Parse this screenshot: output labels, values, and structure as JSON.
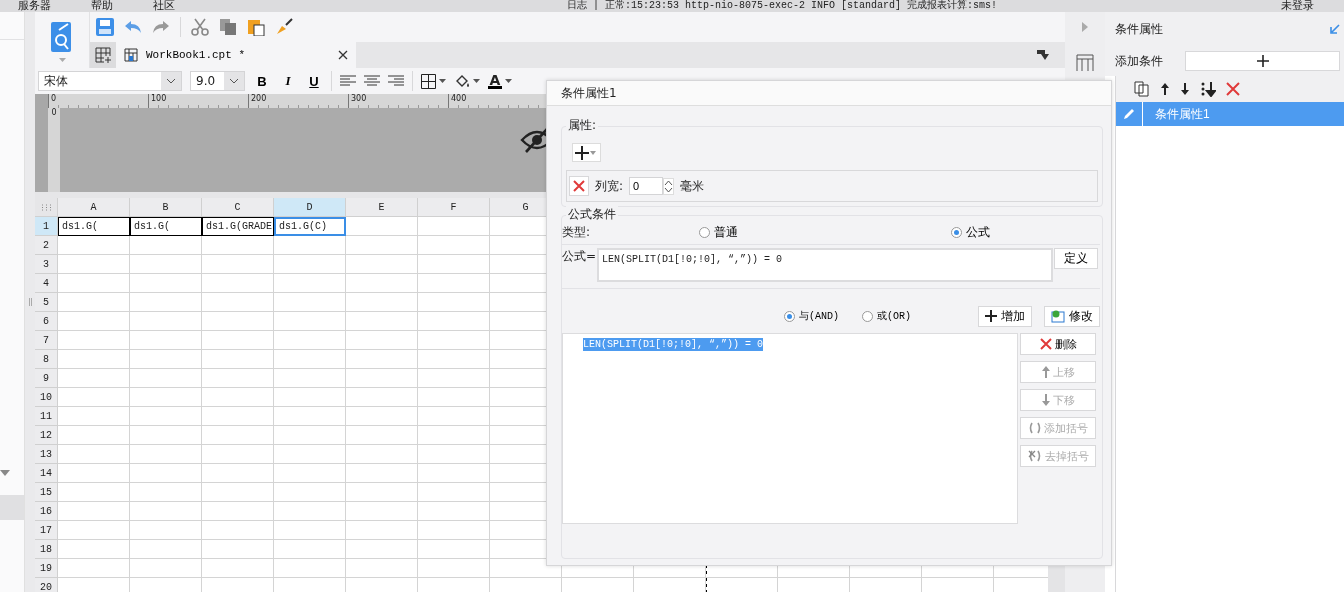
{
  "menu_bar": {
    "items": [
      "服务器",
      "帮助",
      "社区"
    ],
    "status": "日志 | 正常:15:23:53 http-nio-8075-exec-2 INFO [standard] 完成报表计算:sms!",
    "login": "未登录"
  },
  "tabs": [
    {
      "label": "WorkBook1.cpt *",
      "selected": true
    }
  ],
  "format_bar": {
    "font": "宋体",
    "size": "9.0",
    "styles": [
      "B",
      "I",
      "U"
    ],
    "color_letter": "A"
  },
  "ruler": {
    "ticks": [
      "0",
      "100",
      "200",
      "300",
      "400"
    ],
    "side_tick": "0"
  },
  "sheet": {
    "columns": [
      "A",
      "B",
      "C",
      "D",
      "E",
      "F",
      "G"
    ],
    "rows": [
      "1",
      "2",
      "3",
      "4",
      "5",
      "6",
      "7",
      "8",
      "9",
      "10",
      "11",
      "12",
      "13",
      "14",
      "15",
      "16",
      "17",
      "18",
      "19",
      "20"
    ],
    "cells": [
      {
        "text": "ds1.G(",
        "selected": false
      },
      {
        "text": "ds1.G(",
        "selected": false
      },
      {
        "text": "ds1.G(GRADE",
        "selected": false
      },
      {
        "text": "ds1.G(C)",
        "selected": true
      }
    ]
  },
  "dialog": {
    "title": "条件属性1",
    "properties": {
      "legend": "属性:",
      "items": [
        {
          "label": "列宽:",
          "value": "0",
          "unit": "毫米"
        }
      ]
    },
    "formula_condition": {
      "legend": "公式条件",
      "type_label": "类型:",
      "types": [
        {
          "label": "普通",
          "selected": false
        },
        {
          "label": "公式",
          "selected": true
        }
      ],
      "formula_label": "公式=",
      "formula": "LEN(SPLIT(D1[!0;!0], “,”)) = 0",
      "define_button": "定义",
      "logic": [
        {
          "label": "与(AND)",
          "selected": true
        },
        {
          "label": "或(OR)",
          "selected": false
        }
      ],
      "add_button": "增加",
      "modify_button": "修改",
      "conditions": [
        {
          "text": "LEN(SPLIT(D1[!0;!0], “,”)) = 0",
          "selected": true
        }
      ],
      "side_buttons": [
        {
          "kind": "delete",
          "label": "删除",
          "disabled": false
        },
        {
          "kind": "up",
          "label": "上移",
          "disabled": true
        },
        {
          "kind": "down",
          "label": "下移",
          "disabled": true
        },
        {
          "kind": "add-paren",
          "label": "添加括号",
          "disabled": true
        },
        {
          "kind": "remove-paren",
          "label": "去掉括号",
          "disabled": true
        }
      ]
    }
  },
  "right_panel": {
    "title": "条件属性",
    "add_label": "添加条件",
    "items": [
      {
        "label": "条件属性1",
        "selected": true
      }
    ]
  }
}
